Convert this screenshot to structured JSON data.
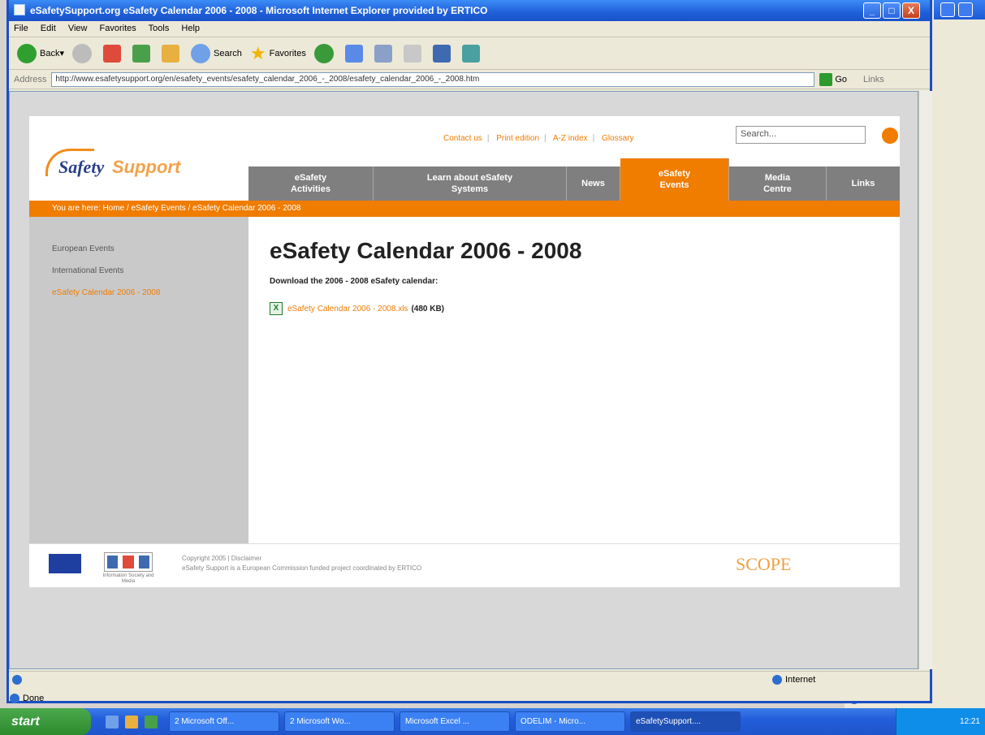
{
  "window": {
    "title": "eSafetySupport.org eSafety Calendar 2006 - 2008 - Microsoft Internet Explorer provided by ERTICO",
    "controls": [
      "_",
      "□",
      "X"
    ]
  },
  "menu": [
    "File",
    "Edit",
    "View",
    "Favorites",
    "Tools",
    "Help"
  ],
  "toolbar": {
    "back": "Back",
    "search": "Search",
    "favorites": "Favorites"
  },
  "address": {
    "label": "Address",
    "url": "http://www.esafetysupport.org/en/esafety_events/esafety_calendar_2006_-_2008/esafety_calendar_2006_-_2008.htm",
    "go": "Go",
    "links": "Links"
  },
  "site": {
    "logo_part1": "Safety",
    "logo_part2": "Support",
    "top_links": [
      "Contact us",
      "Print edition",
      "A-Z index",
      "Glossary"
    ],
    "search_placeholder": "Search...",
    "nav": [
      {
        "line1": "eSafety",
        "line2": "Activities"
      },
      {
        "line1": "Learn about eSafety",
        "line2": "Systems"
      },
      {
        "line1": "News",
        "line2": ""
      },
      {
        "line1": "eSafety",
        "line2": "Events"
      },
      {
        "line1": "Media",
        "line2": "Centre"
      },
      {
        "line1": "Links",
        "line2": ""
      }
    ],
    "breadcrumb": "You are here: Home  /  eSafety Events  /  eSafety Calendar 2006 - 2008",
    "sidebar": [
      "European Events",
      "International Events",
      "eSafety Calendar 2006 - 2008"
    ],
    "heading": "eSafety Calendar 2006 - 2008",
    "download_label": "Download the 2006 - 2008 eSafety calendar:",
    "download_link": "eSafety Calendar 2006 - 2008.xls",
    "download_size": "(480 KB)",
    "footer_copyright": "Copyright 2005  |  Disclaimer",
    "footer_disclaimer": "Disclaimer",
    "footer_line2": "eSafety Support is a European Commission funded project coordinated by ERTICO",
    "isoc_caption": "Information Society and Media",
    "scope": "SCOPE"
  },
  "status": {
    "left": "",
    "zone": "Internet",
    "done": "Done"
  },
  "taskbar": {
    "start": "start",
    "tasks": [
      "2 Microsoft Off...",
      "2 Microsoft Wo...",
      "Microsoft Excel ...",
      "ODELIM - Micro...",
      "eSafetySupport...."
    ],
    "time": "12:21"
  },
  "colors": {
    "accent": "#f07c00",
    "nav_gray": "#7f7f7f",
    "sidebar_gray": "#c9c9c9",
    "xp_blue": "#245edb"
  }
}
